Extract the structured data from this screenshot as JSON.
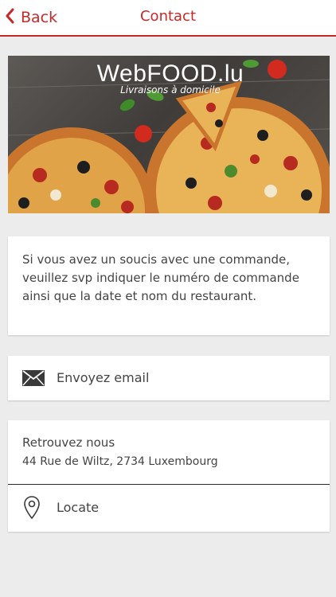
{
  "nav": {
    "back_label": "Back",
    "title": "Contact",
    "accent_color": "#c62828"
  },
  "banner": {
    "brand_name": "WebFOOD.lu",
    "tagline": "Livraisons à domicile"
  },
  "info": {
    "text": "Si vous avez un soucis avec une commande, veuillez svp indiquer le numéro de commande ainsi que la date et nom du restaurant."
  },
  "email": {
    "icon": "envelope-icon",
    "label": "Envoyez email"
  },
  "location": {
    "heading": "Retrouvez nous",
    "address": "44 Rue de Wiltz, 2734 Luxembourg",
    "icon": "map-pin-icon",
    "locate_label": "Locate"
  }
}
